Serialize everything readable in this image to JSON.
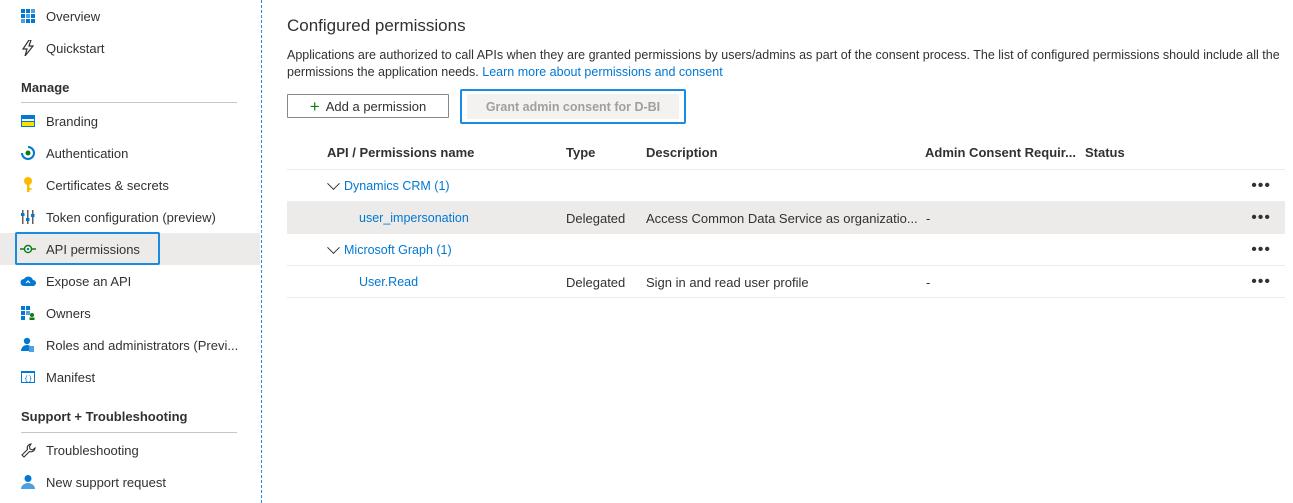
{
  "sidebar": {
    "items": [
      {
        "label": "Overview",
        "icon": "grid-icon"
      },
      {
        "label": "Quickstart",
        "icon": "lightning-icon"
      },
      {
        "label": "Branding",
        "icon": "branding-icon"
      },
      {
        "label": "Authentication",
        "icon": "authentication-icon"
      },
      {
        "label": "Certificates & secrets",
        "icon": "key-icon"
      },
      {
        "label": "Token configuration (preview)",
        "icon": "token-config-icon"
      },
      {
        "label": "API permissions",
        "icon": "api-permissions-icon",
        "selected": true
      },
      {
        "label": "Expose an API",
        "icon": "cloud-icon"
      },
      {
        "label": "Owners",
        "icon": "owners-icon"
      },
      {
        "label": "Roles and administrators (Previ...",
        "icon": "roles-icon"
      },
      {
        "label": "Manifest",
        "icon": "manifest-icon"
      },
      {
        "label": "Troubleshooting",
        "icon": "wrench-icon"
      },
      {
        "label": "New support request",
        "icon": "support-person-icon"
      }
    ],
    "sections": {
      "manage": "Manage",
      "support": "Support + Troubleshooting"
    }
  },
  "main": {
    "title": "Configured permissions",
    "description": "Applications are authorized to call APIs when they are granted permissions by users/admins as part of the consent process. The list of configured permissions should include all the permissions the application needs.",
    "learn_more": "Learn more about permissions and consent",
    "add_button": "Add a permission",
    "grant_button": "Grant admin consent for D-BI",
    "columns": [
      "API / Permissions name",
      "Type",
      "Description",
      "Admin Consent Requir...",
      "Status"
    ],
    "groups": [
      {
        "name": "Dynamics CRM (1)",
        "permissions": [
          {
            "name": "user_impersonation",
            "type": "Delegated",
            "description": "Access Common Data Service as organizatio...",
            "admin_consent": "-",
            "status": ""
          }
        ]
      },
      {
        "name": "Microsoft Graph (1)",
        "permissions": [
          {
            "name": "User.Read",
            "type": "Delegated",
            "description": "Sign in and read user profile",
            "admin_consent": "-",
            "status": ""
          }
        ]
      }
    ],
    "more_glyph": "•••"
  },
  "colors": {
    "accent": "#0078d4",
    "highlight_box": "#1b8be0",
    "selected_bg": "#edebe9",
    "add_plus": "#107c10"
  }
}
